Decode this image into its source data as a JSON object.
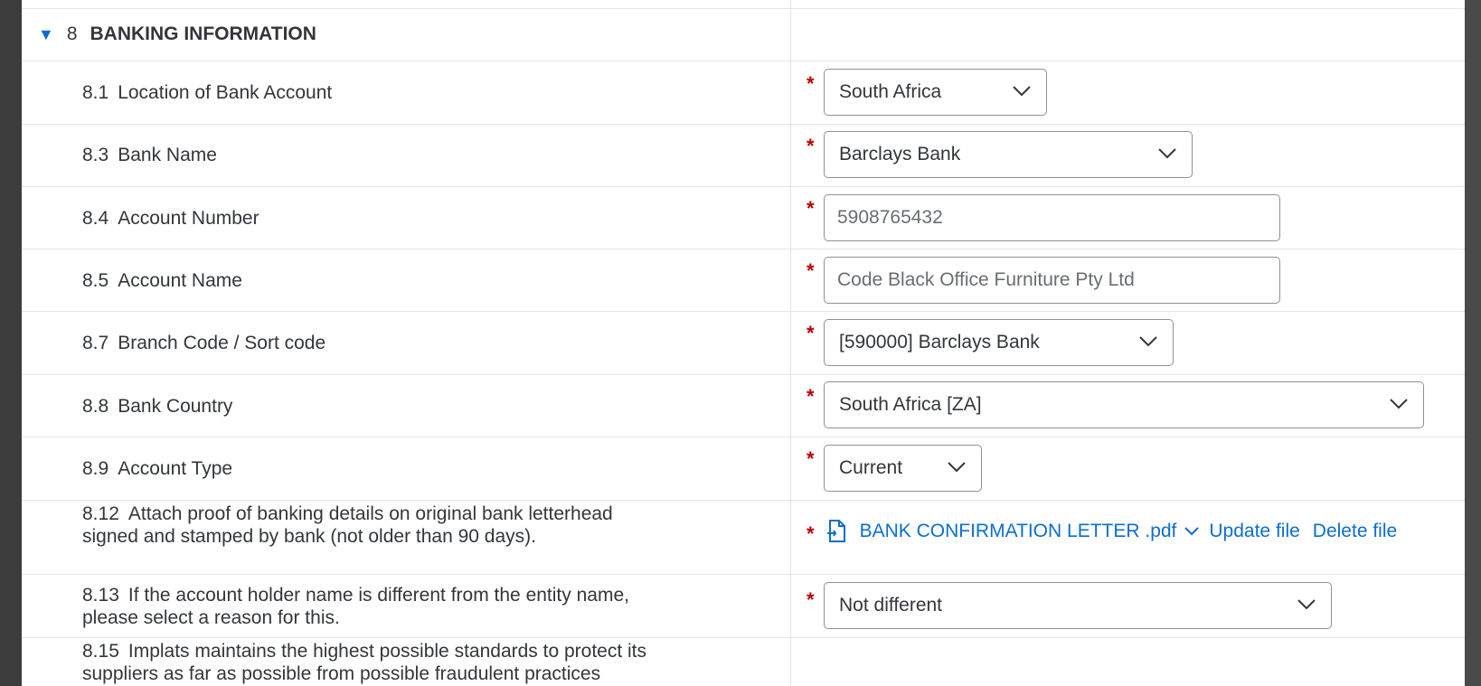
{
  "section": {
    "number": "8",
    "title": "BANKING INFORMATION"
  },
  "fields": [
    {
      "num": "8.1",
      "label": "Location of Bank Account",
      "value": "South Africa"
    },
    {
      "num": "8.3",
      "label": "Bank Name",
      "value": "Barclays Bank"
    },
    {
      "num": "8.4",
      "label": "Account Number",
      "value": "5908765432"
    },
    {
      "num": "8.5",
      "label": "Account Name",
      "value": "Code Black Office Furniture Pty Ltd"
    },
    {
      "num": "8.7",
      "label": "Branch Code / Sort code",
      "value": "[590000] Barclays Bank"
    },
    {
      "num": "8.8",
      "label": "Bank Country",
      "value": "South Africa [ZA]"
    },
    {
      "num": "8.9",
      "label": "Account Type",
      "value": "Current"
    },
    {
      "num": "8.12",
      "label": "Attach proof of banking details on original bank letterhead signed and stamped by bank (not older than 90 days).",
      "file_name": "BANK CONFIRMATION LETTER .pdf",
      "update_label": "Update file",
      "delete_label": "Delete file"
    },
    {
      "num": "8.13",
      "label": "If the account holder name is different from the entity name, please select a reason for this.",
      "value": "Not different"
    },
    {
      "num": "8.15",
      "label": "Implats maintains the highest possible standards to protect its suppliers as far as possible from possible fraudulent practices"
    }
  ],
  "required_marker": "*",
  "icons": {
    "caret": "triangle-down-icon",
    "chevron": "chevron-down-icon",
    "file": "pdf-file-icon"
  },
  "colors": {
    "accent": "#0a6ed1",
    "required": "#bb0000",
    "text": "#32363a",
    "border": "#89919a"
  }
}
